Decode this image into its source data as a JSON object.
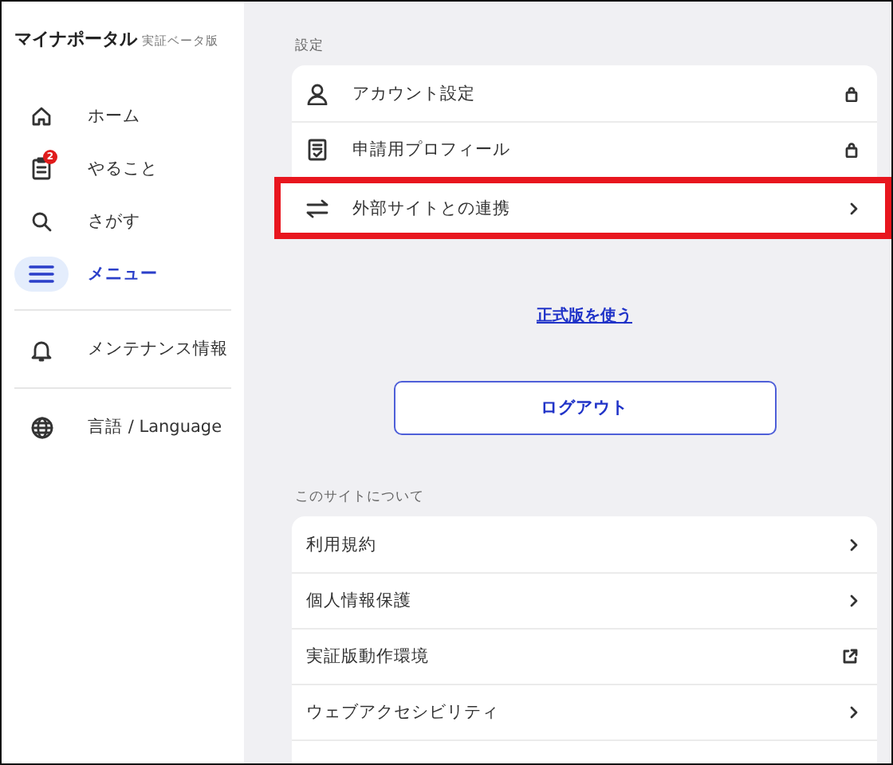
{
  "sidebar": {
    "title": "マイナポータル",
    "subtitle": "実証ベータ版",
    "nav": [
      {
        "label": "ホーム",
        "selected": false
      },
      {
        "label": "やること",
        "selected": false,
        "badge": "2"
      },
      {
        "label": "さがす",
        "selected": false
      },
      {
        "label": "メニュー",
        "selected": true
      }
    ],
    "extra": [
      {
        "label": "メンテナンス情報"
      },
      {
        "label": "言語 / Language"
      }
    ]
  },
  "settings": {
    "heading": "設定",
    "items": [
      {
        "label": "アカウント設定",
        "kind": "locked",
        "highlighted": false
      },
      {
        "label": "申請用プロフィール",
        "kind": "locked",
        "highlighted": false
      },
      {
        "label": "外部サイトとの連携",
        "kind": "link",
        "highlighted": true
      }
    ]
  },
  "official_link": "正式版を使う",
  "logout": "ログアウト",
  "about": {
    "heading": "このサイトについて",
    "items": [
      {
        "label": "利用規約",
        "kind": "link"
      },
      {
        "label": "個人情報保護",
        "kind": "link"
      },
      {
        "label": "実証版動作環境",
        "kind": "external"
      },
      {
        "label": "ウェブアクセシビリティ",
        "kind": "link"
      }
    ]
  }
}
